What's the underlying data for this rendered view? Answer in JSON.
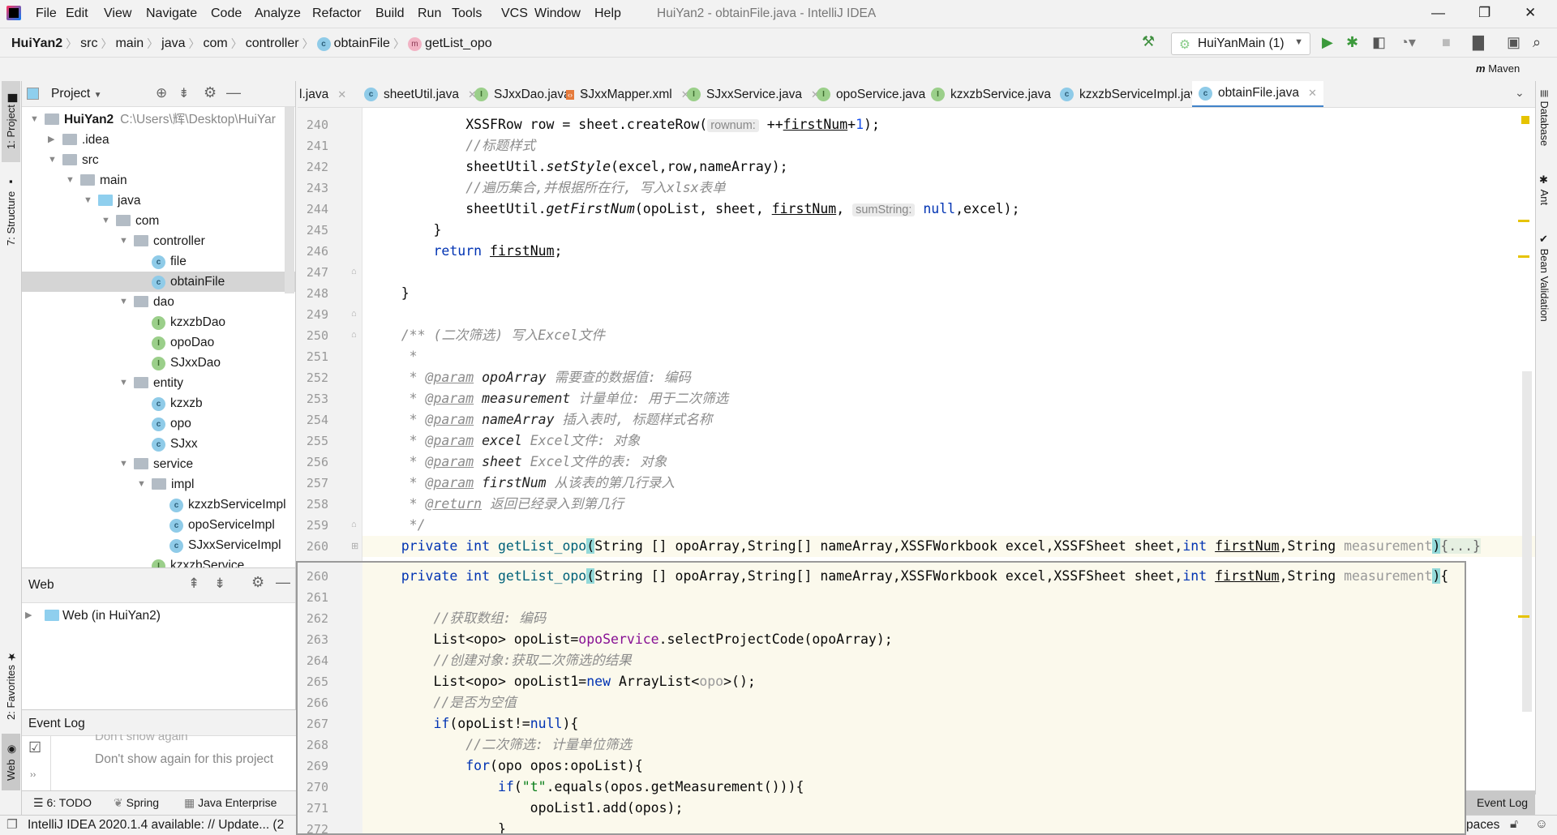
{
  "menu": {
    "items": [
      "File",
      "Edit",
      "View",
      "Navigate",
      "Code",
      "Analyze",
      "Refactor",
      "Build",
      "Run",
      "Tools",
      "VCS",
      "Window",
      "Help"
    ],
    "window_title": "HuiYan2 - obtainFile.java - IntelliJ IDEA"
  },
  "breadcrumb": [
    "HuiYan2",
    "src",
    "main",
    "java",
    "com",
    "controller",
    "obtainFile",
    "getList_opo"
  ],
  "toolbar": {
    "run_config": "HuiYanMain (1)",
    "maven": "Maven"
  },
  "left_strip": {
    "project": "1: Project",
    "structure": "7: Structure",
    "favorites": "2: Favorites",
    "web": "Web"
  },
  "right_strip": {
    "database": "Database",
    "ant": "Ant",
    "bean": "Bean Validation"
  },
  "project": {
    "title": "Project",
    "root_path": "C:\\Users\\辉\\Desktop\\HuiYar",
    "tree": [
      {
        "label": "HuiYan2",
        "level": 0,
        "type": "module",
        "expanded": true
      },
      {
        "label": ".idea",
        "level": 1,
        "type": "folder",
        "expanded": false
      },
      {
        "label": "src",
        "level": 1,
        "type": "folder",
        "expanded": true
      },
      {
        "label": "main",
        "level": 2,
        "type": "folder",
        "expanded": true
      },
      {
        "label": "java",
        "level": 3,
        "type": "srcfolder",
        "expanded": true
      },
      {
        "label": "com",
        "level": 4,
        "type": "package",
        "expanded": true
      },
      {
        "label": "controller",
        "level": 5,
        "type": "package",
        "expanded": true
      },
      {
        "label": "file",
        "level": 6,
        "type": "class"
      },
      {
        "label": "obtainFile",
        "level": 6,
        "type": "class",
        "selected": true
      },
      {
        "label": "dao",
        "level": 5,
        "type": "package",
        "expanded": true
      },
      {
        "label": "kzxzbDao",
        "level": 6,
        "type": "interface"
      },
      {
        "label": "opoDao",
        "level": 6,
        "type": "interface"
      },
      {
        "label": "SJxxDao",
        "level": 6,
        "type": "interface"
      },
      {
        "label": "entity",
        "level": 5,
        "type": "package",
        "expanded": true
      },
      {
        "label": "kzxzb",
        "level": 6,
        "type": "class"
      },
      {
        "label": "opo",
        "level": 6,
        "type": "class"
      },
      {
        "label": "SJxx",
        "level": 6,
        "type": "class"
      },
      {
        "label": "service",
        "level": 5,
        "type": "package",
        "expanded": true
      },
      {
        "label": "impl",
        "level": 6,
        "type": "package",
        "expanded": true
      },
      {
        "label": "kzxzbServiceImpl",
        "level": 7,
        "type": "class"
      },
      {
        "label": "opoServiceImpl",
        "level": 7,
        "type": "class"
      },
      {
        "label": "SJxxServiceImpl",
        "level": 7,
        "type": "class"
      },
      {
        "label": "kzxzbService",
        "level": 6,
        "type": "interface"
      }
    ]
  },
  "web": {
    "title": "Web",
    "item": "Web (in HuiYan2)"
  },
  "event_log": {
    "title": "Event Log",
    "line1": "Don't show again",
    "line2": "Don't show again for this project"
  },
  "bottom_tools": {
    "todo": "6: TODO",
    "spring": "Spring",
    "javaee": "Java Enterprise",
    "eventlog": "Event Log"
  },
  "status": {
    "message": "IntelliJ IDEA 2020.1.4 available: // Update... (2",
    "indent": "paces"
  },
  "tabs": [
    {
      "label": "l.java",
      "icon": "none"
    },
    {
      "label": "sheetUtil.java",
      "icon": "class"
    },
    {
      "label": "SJxxDao.java",
      "icon": "interface"
    },
    {
      "label": "SJxxMapper.xml",
      "icon": "xml"
    },
    {
      "label": "SJxxService.java",
      "icon": "interface"
    },
    {
      "label": "opoService.java",
      "icon": "interface"
    },
    {
      "label": "kzxzbService.java",
      "icon": "interface"
    },
    {
      "label": "kzxzbServiceImpl.java",
      "icon": "class"
    },
    {
      "label": "obtainFile.java",
      "icon": "class",
      "active": true
    }
  ],
  "editor": {
    "lines": [
      {
        "n": "240",
        "t": [
          [
            "t",
            "            XSSFRow row = sheet.createRow("
          ],
          [
            "h",
            "rownum:"
          ],
          [
            "t",
            " ++"
          ],
          [
            "u",
            "firstNum"
          ],
          [
            "t",
            "+"
          ],
          [
            "n",
            "1"
          ],
          [
            "t",
            ");"
          ]
        ]
      },
      {
        "n": "241",
        "t": [
          [
            "c",
            "            //标题样式"
          ]
        ]
      },
      {
        "n": "242",
        "t": [
          [
            "t",
            "            sheetUtil."
          ],
          [
            "i",
            "setStyle"
          ],
          [
            "t",
            "(excel,row,nameArray);"
          ]
        ]
      },
      {
        "n": "243",
        "t": [
          [
            "c",
            "            //遍历集合,并根据所在行, 写入xlsx表单"
          ]
        ]
      },
      {
        "n": "244",
        "t": [
          [
            "t",
            "            sheetUtil."
          ],
          [
            "i",
            "getFirstNum"
          ],
          [
            "t",
            "(opoList, sheet, "
          ],
          [
            "u",
            "firstNum"
          ],
          [
            "t",
            ", "
          ],
          [
            "h",
            "sumString:"
          ],
          [
            "t",
            " "
          ],
          [
            "k",
            "null"
          ],
          [
            "t",
            ",excel);"
          ]
        ]
      },
      {
        "n": "245",
        "t": [
          [
            "t",
            "        }"
          ]
        ]
      },
      {
        "n": "246",
        "t": [
          [
            "t",
            "        "
          ],
          [
            "k",
            "return"
          ],
          [
            "t",
            " "
          ],
          [
            "u",
            "firstNum"
          ],
          [
            "t",
            ";"
          ]
        ]
      },
      {
        "n": "247",
        "t": []
      },
      {
        "n": "248",
        "t": [
          [
            "t",
            "    }"
          ]
        ]
      },
      {
        "n": "249",
        "t": []
      },
      {
        "n": "250",
        "t": [
          [
            "c",
            "    /** (二次筛选) 写入Excel文件"
          ]
        ]
      },
      {
        "n": "251",
        "t": [
          [
            "c",
            "     *"
          ]
        ]
      },
      {
        "n": "252",
        "t": [
          [
            "c",
            "     * "
          ],
          [
            "tag",
            "@param"
          ],
          [
            "t",
            " "
          ],
          [
            "jp",
            "opoArray"
          ],
          [
            "c",
            " 需要查的数据值: 编码"
          ]
        ]
      },
      {
        "n": "253",
        "t": [
          [
            "c",
            "     * "
          ],
          [
            "tag",
            "@param"
          ],
          [
            "t",
            " "
          ],
          [
            "jp",
            "measurement"
          ],
          [
            "c",
            " 计量单位: 用于二次筛选"
          ]
        ]
      },
      {
        "n": "254",
        "t": [
          [
            "c",
            "     * "
          ],
          [
            "tag",
            "@param"
          ],
          [
            "t",
            " "
          ],
          [
            "jp",
            "nameArray"
          ],
          [
            "c",
            " 插入表时, 标题样式名称"
          ]
        ]
      },
      {
        "n": "255",
        "t": [
          [
            "c",
            "     * "
          ],
          [
            "tag",
            "@param"
          ],
          [
            "t",
            " "
          ],
          [
            "jp",
            "excel"
          ],
          [
            "c",
            " Excel文件: 对象"
          ]
        ]
      },
      {
        "n": "256",
        "t": [
          [
            "c",
            "     * "
          ],
          [
            "tag",
            "@param"
          ],
          [
            "t",
            " "
          ],
          [
            "jp",
            "sheet"
          ],
          [
            "c",
            " Excel文件的表: 对象"
          ]
        ]
      },
      {
        "n": "257",
        "t": [
          [
            "c",
            "     * "
          ],
          [
            "tag",
            "@param"
          ],
          [
            "t",
            " "
          ],
          [
            "jp",
            "firstNum"
          ],
          [
            "c",
            " 从该表的第几行录入"
          ]
        ]
      },
      {
        "n": "258",
        "t": [
          [
            "c",
            "     * "
          ],
          [
            "tag",
            "@return"
          ],
          [
            "c",
            " 返回已经录入到第几行"
          ]
        ]
      },
      {
        "n": "259",
        "t": [
          [
            "c",
            "     */"
          ]
        ]
      },
      {
        "n": "260",
        "caret": true,
        "t": [
          [
            "t",
            "    "
          ],
          [
            "k",
            "private int"
          ],
          [
            "t",
            " "
          ],
          [
            "m",
            "getList_opo"
          ],
          [
            "bm",
            "("
          ],
          [
            "t",
            "String [] opoArray,String[] nameArray,XSSFWorkbook excel,XSSFSheet sheet,"
          ],
          [
            "k",
            "int"
          ],
          [
            "t",
            " "
          ],
          [
            "u",
            "firstNum"
          ],
          [
            "t",
            ",String "
          ],
          [
            "p",
            "measurement"
          ],
          [
            "bm",
            ")"
          ],
          [
            "fold",
            "{...}"
          ]
        ]
      }
    ]
  },
  "popup": {
    "lines": [
      {
        "n": "260",
        "t": [
          [
            "t",
            "    "
          ],
          [
            "k",
            "private int"
          ],
          [
            "t",
            " "
          ],
          [
            "m",
            "getList_opo"
          ],
          [
            "bm",
            "("
          ],
          [
            "t",
            "String [] opoArray,String[] nameArray,XSSFWorkbook excel,XSSFSheet sheet,"
          ],
          [
            "k",
            "int"
          ],
          [
            "t",
            " "
          ],
          [
            "u",
            "firstNum"
          ],
          [
            "t",
            ",String "
          ],
          [
            "p",
            "measurement"
          ],
          [
            "bm",
            ")"
          ],
          [
            "t",
            "{"
          ]
        ]
      },
      {
        "n": "261",
        "t": []
      },
      {
        "n": "262",
        "t": [
          [
            "c",
            "        //获取数组: 编码"
          ]
        ]
      },
      {
        "n": "263",
        "t": [
          [
            "t",
            "        List<opo> opoList="
          ],
          [
            "f",
            "opoService"
          ],
          [
            "t",
            ".selectProjectCode(opoArray);"
          ]
        ]
      },
      {
        "n": "264",
        "t": [
          [
            "c",
            "        //创建对象:获取二次筛选的结果"
          ]
        ]
      },
      {
        "n": "265",
        "t": [
          [
            "t",
            "        List<opo> opoList1="
          ],
          [
            "k",
            "new"
          ],
          [
            "t",
            " ArrayList<"
          ],
          [
            "p",
            "opo"
          ],
          [
            "t",
            ">();"
          ]
        ]
      },
      {
        "n": "266",
        "t": [
          [
            "c",
            "        //是否为空值"
          ]
        ]
      },
      {
        "n": "267",
        "t": [
          [
            "t",
            "        "
          ],
          [
            "k",
            "if"
          ],
          [
            "t",
            "(opoList!="
          ],
          [
            "k",
            "null"
          ],
          [
            "t",
            "){"
          ]
        ]
      },
      {
        "n": "268",
        "t": [
          [
            "c",
            "            //二次筛选: 计量单位筛选"
          ]
        ]
      },
      {
        "n": "269",
        "t": [
          [
            "t",
            "            "
          ],
          [
            "k",
            "for"
          ],
          [
            "t",
            "(opo opos:opoList){"
          ]
        ]
      },
      {
        "n": "270",
        "t": [
          [
            "t",
            "                "
          ],
          [
            "k",
            "if"
          ],
          [
            "t",
            "("
          ],
          [
            "s",
            "\"t\""
          ],
          [
            "t",
            ".equals(opos.getMeasurement())){"
          ]
        ]
      },
      {
        "n": "271",
        "t": [
          [
            "t",
            "                    opoList1.add(opos);"
          ]
        ]
      },
      {
        "n": "272",
        "t": [
          [
            "t",
            "                }"
          ]
        ]
      }
    ]
  },
  "colors": {
    "keyword": "#0033b3",
    "comment": "#8c8c8c",
    "field": "#871094",
    "string": "#067d17",
    "number": "#1750eb",
    "accent": "#4083c9",
    "caret_line": "#fcfaed"
  }
}
